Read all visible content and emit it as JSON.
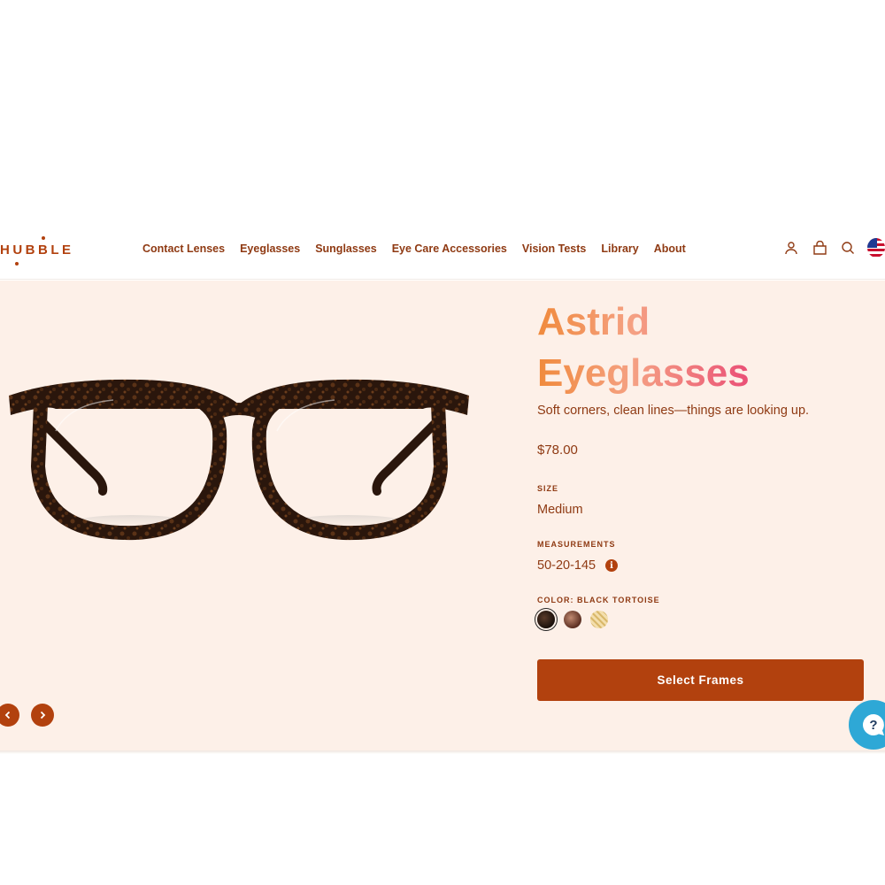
{
  "brand": {
    "logo_text": "HUBBLE"
  },
  "nav": {
    "items": [
      {
        "label": "Contact Lenses"
      },
      {
        "label": "Eyeglasses"
      },
      {
        "label": "Sunglasses"
      },
      {
        "label": "Eye Care Accessories"
      },
      {
        "label": "Vision Tests"
      },
      {
        "label": "Library"
      },
      {
        "label": "About"
      }
    ]
  },
  "header_icons": [
    "account-icon",
    "cart-icon",
    "search-icon",
    "us-flag-icon"
  ],
  "product": {
    "title_line1": "Astrid",
    "title_line2": "Eyeglasses",
    "tagline": "Soft corners, clean lines—things are looking up.",
    "price": "$78.00",
    "size_label": "SIZE",
    "size_value": "Medium",
    "measurements_label": "MEASUREMENTS",
    "measurements_value": "50-20-145",
    "color_label": "COLOR: BLACK TORTOISE",
    "swatches": [
      {
        "name": "Black Tortoise",
        "selected": true
      },
      {
        "name": "Tortoise",
        "selected": false
      },
      {
        "name": "Gold",
        "selected": false
      }
    ],
    "cta_label": "Select Frames"
  },
  "colors": {
    "accent": "#b2410e",
    "text": "#8f3a13",
    "hero_bg": "#fdf0e8",
    "help_bubble": "#2ea8d6"
  }
}
